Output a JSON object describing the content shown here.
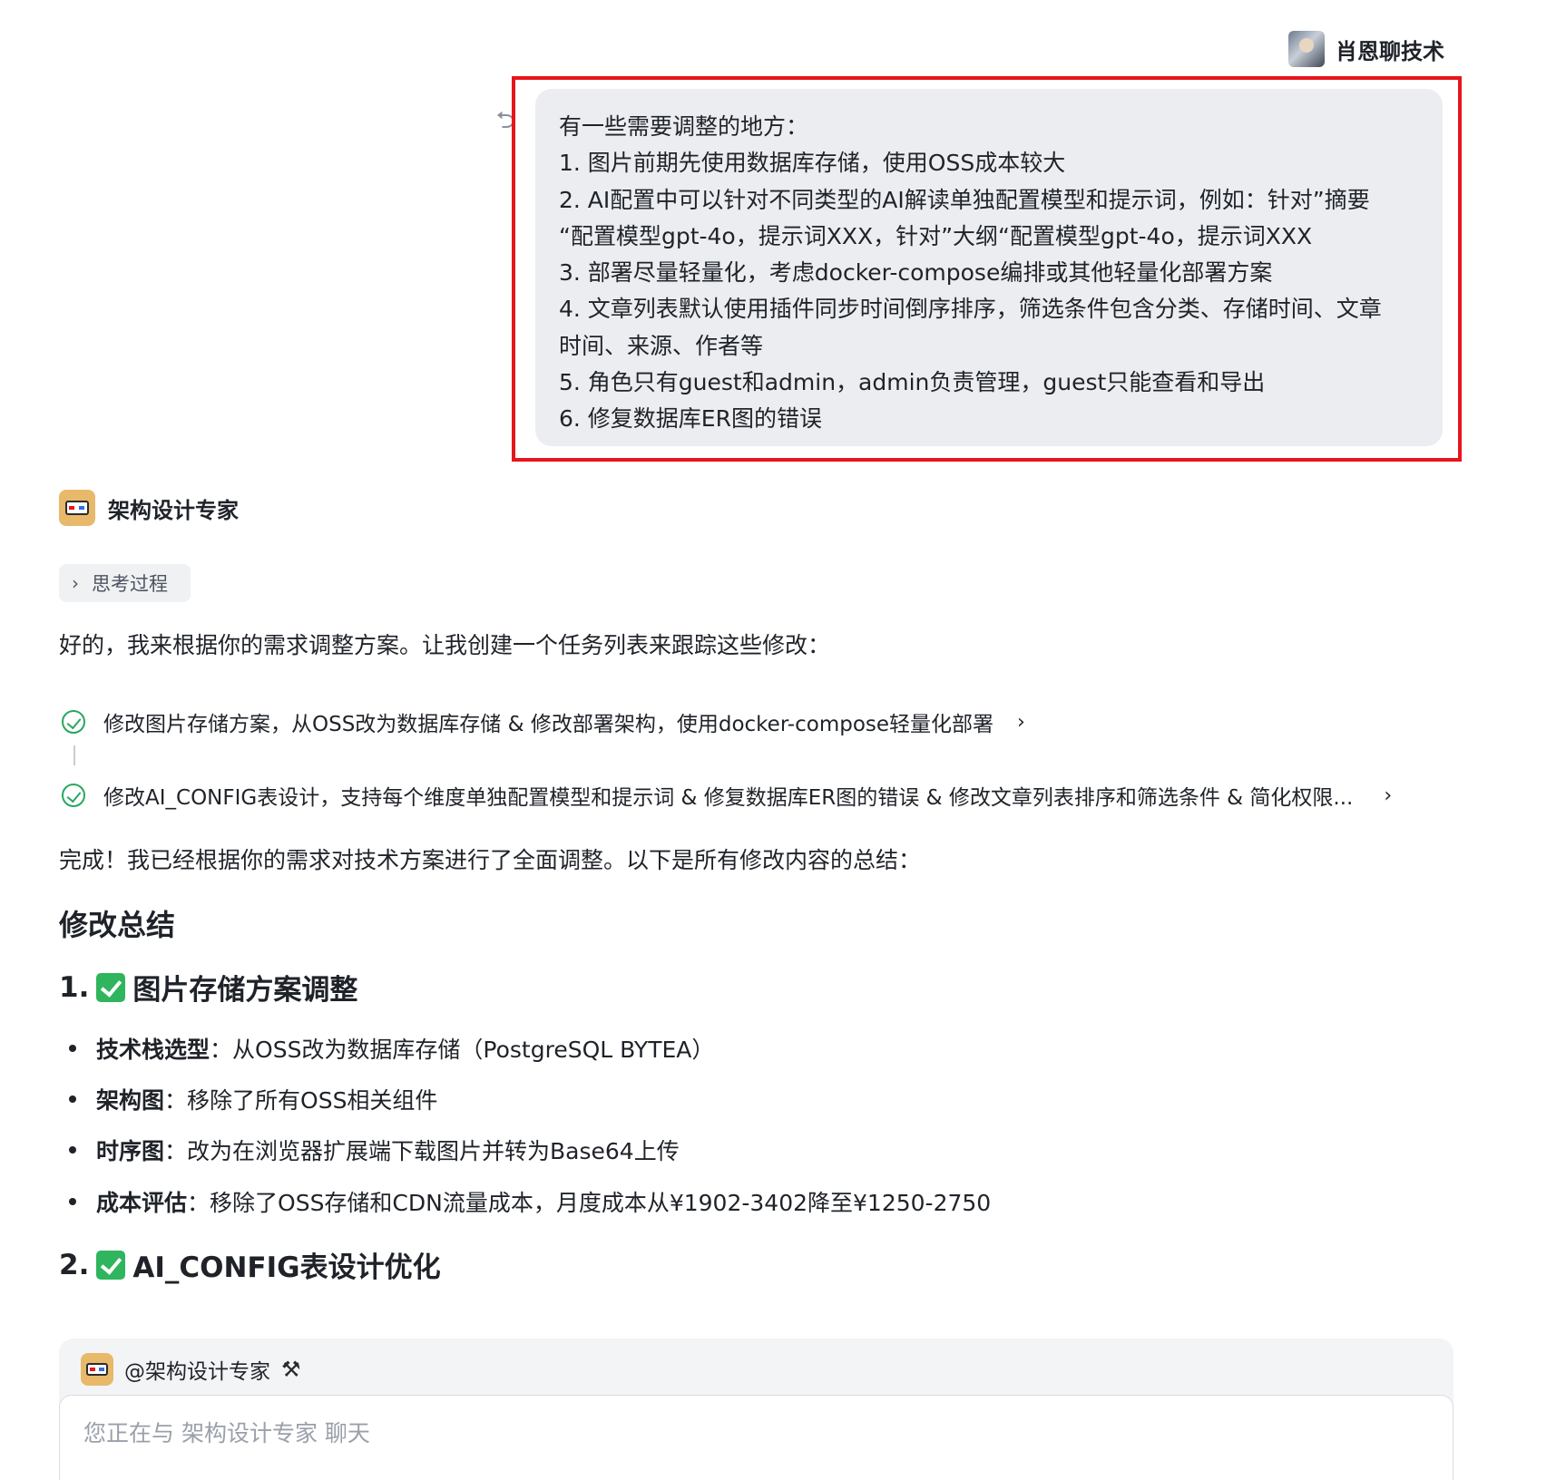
{
  "user": {
    "name": "肖恩聊技术"
  },
  "user_message": {
    "lines": [
      "有一些需要调整的地方：",
      "1. 图片前期先使用数据库存储，使用OSS成本较大",
      "2. AI配置中可以针对不同类型的AI解读单独配置模型和提示词，例如：针对”摘要",
      "“配置模型gpt-4o，提示词XXX，针对”大纲“配置模型gpt-4o，提示词XXX",
      "3. 部署尽量轻量化，考虑docker-compose编排或其他轻量化部署方案",
      "4. 文章列表默认使用插件同步时间倒序排序，筛选条件包含分类、存储时间、文章",
      "时间、来源、作者等",
      "5. 角色只有guest和admin，admin负责管理，guest只能查看和导出",
      "6. 修复数据库ER图的错误"
    ]
  },
  "assistant": {
    "name": "架构设计专家",
    "thinking_label": "思考过程",
    "intro": "好的，我来根据你的需求调整方案。让我创建一个任务列表来跟踪这些修改：",
    "tasks": [
      "修改图片存储方案，从OSS改为数据库存储 & 修改部署架构，使用docker-compose轻量化部署",
      "修改AI_CONFIG表设计，支持每个维度单独配置模型和提示词 & 修复数据库ER图的错误 & 修改文章列表排序和筛选条件 & 简化权限..."
    ],
    "done_text": "完成！我已经根据你的需求对技术方案进行了全面调整。以下是所有修改内容的总结：",
    "summary_title": "修改总结",
    "section1": {
      "num": "1.",
      "title": "图片存储方案调整",
      "bullets": [
        {
          "label": "技术栈选型",
          "text": "：从OSS改为数据库存储（PostgreSQL BYTEA）"
        },
        {
          "label": "架构图",
          "text": "：移除了所有OSS相关组件"
        },
        {
          "label": "时序图",
          "text": "：改为在浏览器扩展端下载图片并转为Base64上传"
        },
        {
          "label": "成本评估",
          "text": "：移除了OSS存储和CDN流量成本，月度成本从¥1902-3402降至¥1250-2750"
        }
      ]
    },
    "section2": {
      "num": "2.",
      "title": "AI_CONFIG表设计优化"
    }
  },
  "composer": {
    "mention": "@架构设计专家",
    "placeholder": "您正在与 架构设计专家 聊天"
  },
  "colors": {
    "highlight": "#e8151b",
    "bubble": "#ebedf0",
    "check": "#2aa660"
  }
}
